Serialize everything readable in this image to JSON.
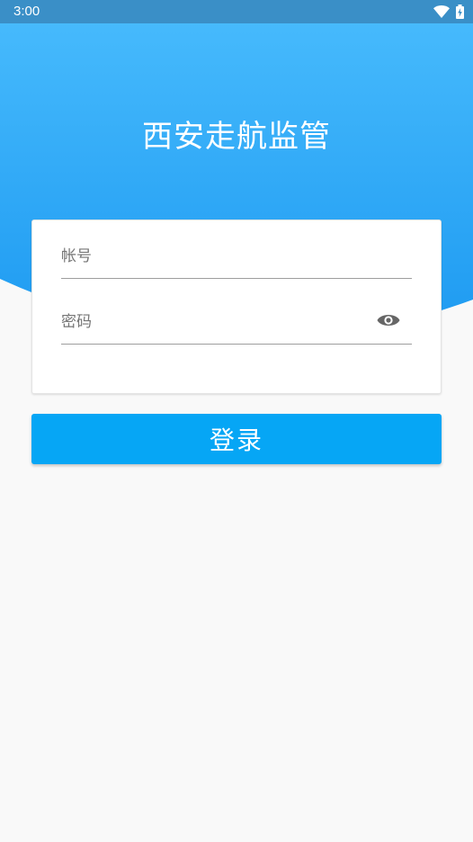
{
  "status_bar": {
    "time": "3:00",
    "icons": [
      "wifi-icon",
      "battery-charging-icon"
    ]
  },
  "header": {
    "title": "西安走航监管"
  },
  "form": {
    "account_placeholder": "帐号",
    "account_value": "",
    "password_placeholder": "密码",
    "password_value": "",
    "show_password_icon": "eye-icon"
  },
  "login_button": {
    "label": "登录"
  },
  "colors": {
    "status_bar": "#3a8fc7",
    "header_top": "#49bcfd",
    "header_bottom": "#1d9af1",
    "primary_button": "#06a6f5",
    "page_background": "#f9f9f9"
  }
}
